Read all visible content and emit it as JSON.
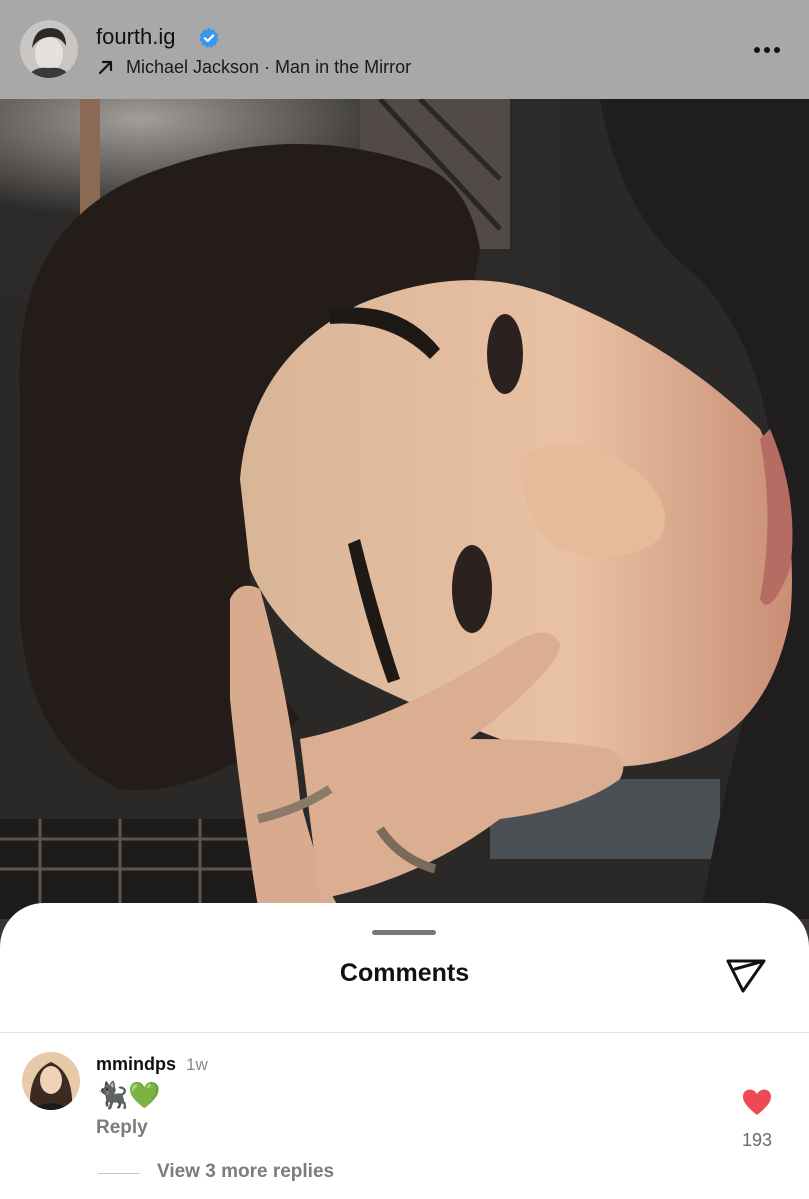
{
  "post": {
    "username": "fourth.ig",
    "verified_icon": "verified-badge-icon",
    "music": "Michael Jackson · Man in the Mirror",
    "music_icon": "arrow-up-right-icon",
    "more_icon": "more-horizontal-icon",
    "photo": "portrait photo"
  },
  "comments_sheet": {
    "title": "Comments",
    "share_icon": "send-icon",
    "comments": [
      {
        "username": "mmindps",
        "time": "1w",
        "text": "🐈‍⬛💚",
        "reply_label": "Reply",
        "likes": "193",
        "like_icon": "heart-filled-icon",
        "view_replies": "View 3 more replies"
      }
    ]
  },
  "colors": {
    "header_bg": "#a9a8a8",
    "verified_blue": "#3897f0",
    "heart_red": "#ed4956"
  }
}
